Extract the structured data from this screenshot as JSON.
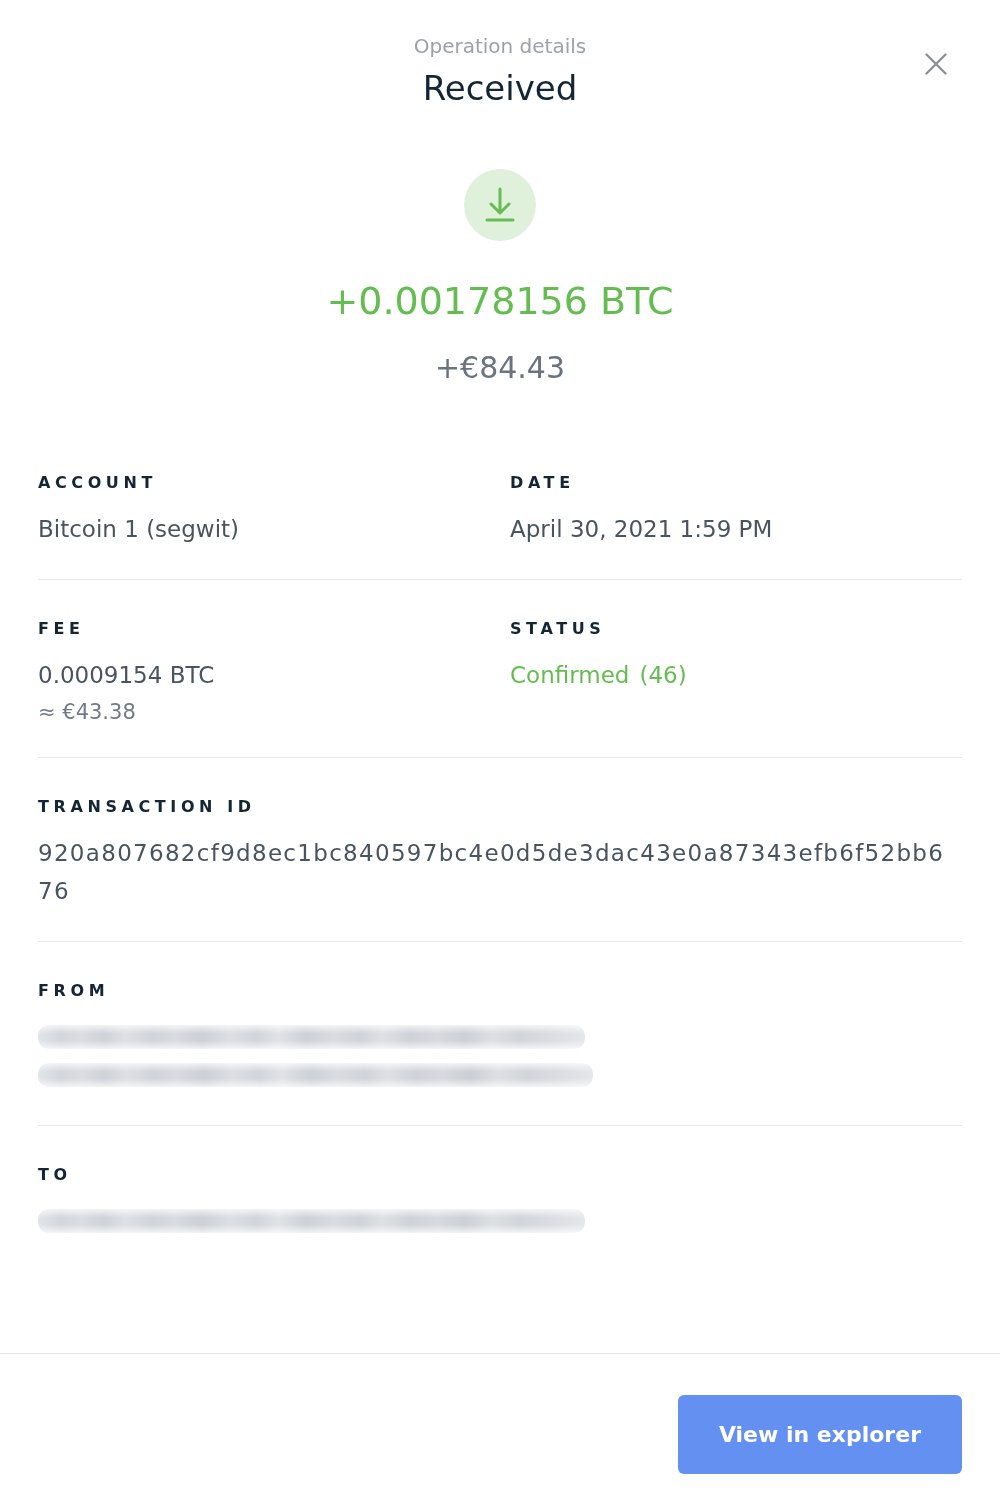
{
  "header": {
    "subtitle": "Operation details",
    "title": "Received"
  },
  "operation": {
    "kind": "incoming",
    "amount": "+0.00178156 BTC",
    "fiat": "+€84.43"
  },
  "details": [
    {
      "fields": [
        {
          "kind": "text",
          "label": "ACCOUNT",
          "value": "Bitcoin 1 (segwit)"
        },
        {
          "kind": "text",
          "label": "DATE",
          "value": "April 30, 2021 1:59 PM"
        }
      ]
    },
    {
      "fields": [
        {
          "kind": "text",
          "label": "FEE",
          "value": "0.0009154 BTC",
          "note": "≈ €43.38"
        },
        {
          "kind": "status",
          "label": "STATUS",
          "value": "Confirmed",
          "count": "(46)",
          "confirmed": true
        }
      ]
    },
    {
      "fields": [
        {
          "kind": "hash",
          "label": "TRANSACTION ID",
          "value": "920a807682cf9d8ec1bc840597bc4e0d5de3dac43e0a87343efb6f52bb676"
        }
      ]
    },
    {
      "fields": [
        {
          "kind": "blurred",
          "label": "FROM",
          "lines": [
            {
              "redacted": true
            },
            {
              "redacted": true
            }
          ]
        }
      ]
    },
    {
      "fields": [
        {
          "kind": "blurred",
          "label": "TO",
          "lines": [
            {
              "redacted": true
            }
          ]
        }
      ]
    }
  ],
  "footer": {
    "button": "View in explorer"
  }
}
